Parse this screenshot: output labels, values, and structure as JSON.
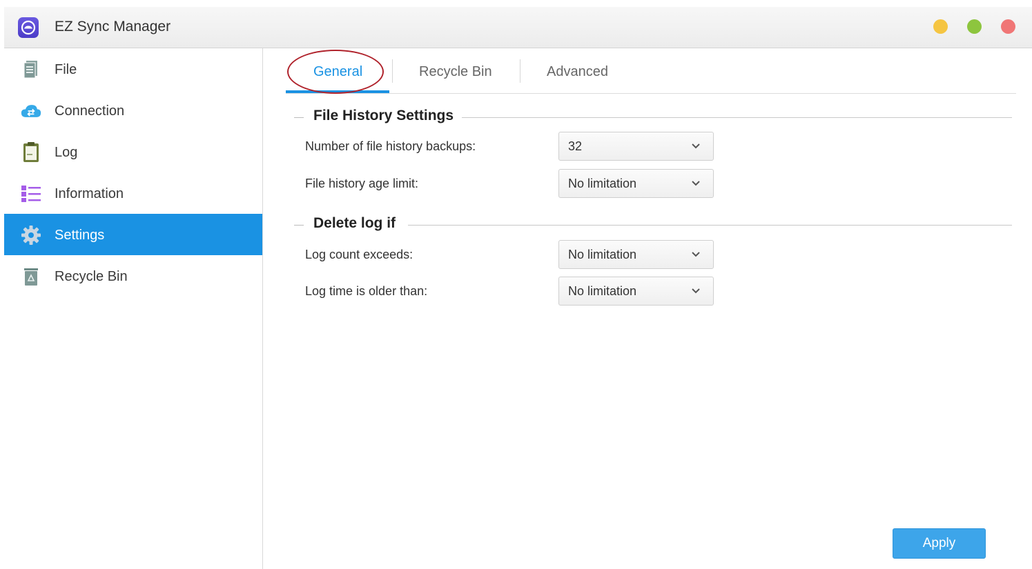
{
  "window": {
    "title": "EZ Sync Manager",
    "app_icon": "cloud-sync-icon",
    "controls": [
      "minimize-dot",
      "maximize-dot",
      "close-dot"
    ]
  },
  "sidebar": {
    "items": [
      {
        "label": "File",
        "icon": "file-icon"
      },
      {
        "label": "Connection",
        "icon": "cloud-connection-icon"
      },
      {
        "label": "Log",
        "icon": "log-clipboard-icon"
      },
      {
        "label": "Information",
        "icon": "information-list-icon"
      },
      {
        "label": "Settings",
        "icon": "gear-icon",
        "active": true
      },
      {
        "label": "Recycle Bin",
        "icon": "recycle-bin-icon"
      }
    ]
  },
  "tabs": [
    {
      "label": "General",
      "active": true
    },
    {
      "label": "Recycle Bin"
    },
    {
      "label": "Advanced"
    }
  ],
  "sections": {
    "file_history": {
      "title": "File History Settings",
      "rows": [
        {
          "label": "Number of file history backups:",
          "value": "32"
        },
        {
          "label": "File history age limit:",
          "value": "No limitation"
        }
      ]
    },
    "delete_log": {
      "title": "Delete log if",
      "rows": [
        {
          "label": "Log count exceeds:",
          "value": "No limitation"
        },
        {
          "label": "Log time is older than:",
          "value": "No limitation"
        }
      ]
    }
  },
  "actions": {
    "apply_label": "Apply"
  },
  "colors": {
    "accent": "#1a92e3",
    "apply_button": "#3da5ea",
    "highlight_ring": "#b0232c",
    "dot_minimize": "#f5c542",
    "dot_maximize": "#8dc53e",
    "dot_close": "#f07676"
  }
}
